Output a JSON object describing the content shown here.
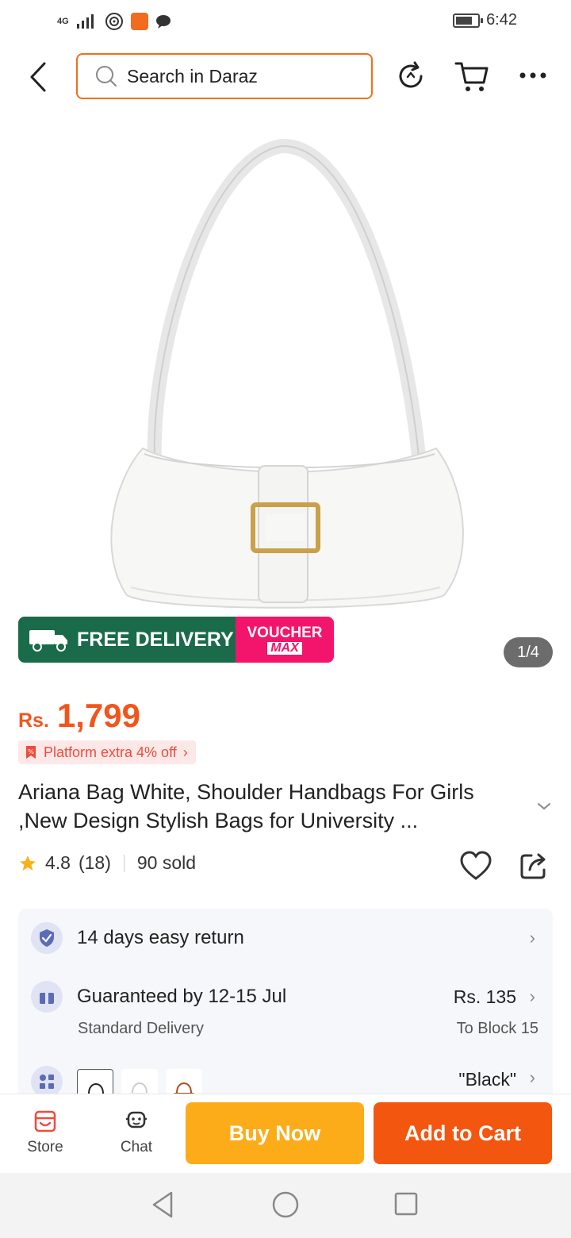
{
  "status_bar": {
    "network": "4G",
    "time": "6:42",
    "battery_level": 0.75
  },
  "header": {
    "search_placeholder": "Search in Daraz"
  },
  "gallery": {
    "counter": "1/4"
  },
  "promo": {
    "free_badge": "FREE",
    "free_delivery": "FREE DELIVERY",
    "voucher_line1": "VOUCHER",
    "voucher_line2": "MAX"
  },
  "price": {
    "currency": "Rs.",
    "amount": "1,799"
  },
  "platform_offer": "Platform extra 4% off",
  "title": "Ariana Bag White, Shoulder Handbags For Girls ,New Design Stylish Bags for University ...",
  "rating": {
    "score": "4.8",
    "count": "(18)",
    "sold": "90 sold"
  },
  "services": {
    "return": "14 days easy return",
    "delivery": "Guaranteed by 12-15 Jul",
    "delivery_type": "Standard Delivery",
    "delivery_fee": "Rs. 135",
    "delivery_to": "To Block 15",
    "variant": "\"Black\""
  },
  "bottom": {
    "store": "Store",
    "chat": "Chat",
    "buy_now": "Buy Now",
    "add_to_cart": "Add to Cart"
  },
  "colors": {
    "brand": "#f36d1d",
    "price": "#f2551c",
    "buy": "#fbac18",
    "cart": "#f3560f",
    "promo_green": "#1a6b4a",
    "promo_pink": "#f3156b"
  }
}
